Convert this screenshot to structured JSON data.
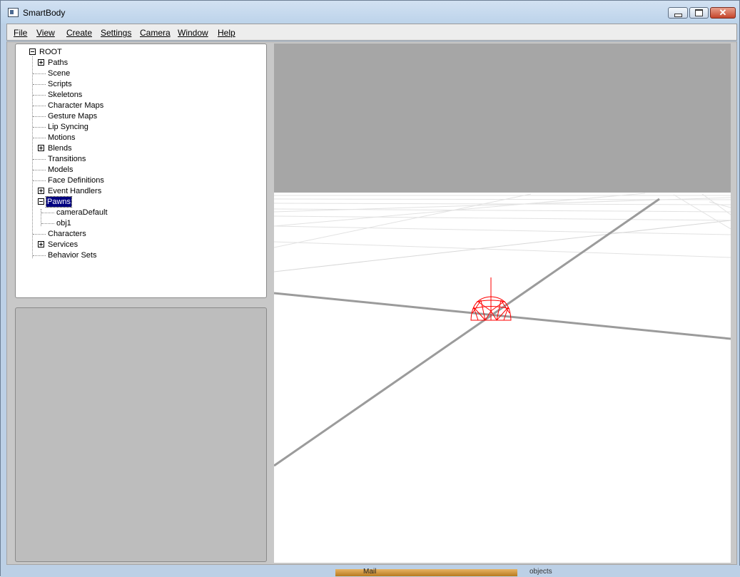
{
  "window": {
    "title": "SmartBody",
    "icon": "app-window-icon",
    "controls": {
      "minimize": "minimize-icon",
      "maximize": "maximize-icon",
      "close": "close-icon",
      "close_glyph": "✕"
    }
  },
  "menubar": {
    "items": [
      {
        "label": "File",
        "name": "menu-file"
      },
      {
        "label": "View",
        "name": "menu-view"
      },
      {
        "label": "Create",
        "name": "menu-create"
      },
      {
        "label": "Settings",
        "name": "menu-settings"
      },
      {
        "label": "Camera",
        "name": "menu-camera"
      },
      {
        "label": "Window",
        "name": "menu-window"
      },
      {
        "label": "Help",
        "name": "menu-help"
      }
    ]
  },
  "tree": {
    "root": {
      "label": "ROOT",
      "expanded": true
    },
    "items": [
      {
        "label": "Paths",
        "expandable": true,
        "expanded": false
      },
      {
        "label": "Scene",
        "expandable": false
      },
      {
        "label": "Scripts",
        "expandable": false
      },
      {
        "label": "Skeletons",
        "expandable": false
      },
      {
        "label": "Character Maps",
        "expandable": false
      },
      {
        "label": "Gesture Maps",
        "expandable": false
      },
      {
        "label": "Lip Syncing",
        "expandable": false
      },
      {
        "label": "Motions",
        "expandable": false
      },
      {
        "label": "Blends",
        "expandable": true,
        "expanded": false
      },
      {
        "label": "Transitions",
        "expandable": false
      },
      {
        "label": "Models",
        "expandable": false
      },
      {
        "label": "Face Definitions",
        "expandable": false
      },
      {
        "label": "Event Handlers",
        "expandable": true,
        "expanded": false
      },
      {
        "label": "Pawns",
        "expandable": true,
        "expanded": true,
        "selected": true,
        "children": [
          {
            "label": "cameraDefault"
          },
          {
            "label": "obj1"
          }
        ]
      },
      {
        "label": "Characters",
        "expandable": false
      },
      {
        "label": "Services",
        "expandable": true,
        "expanded": false
      },
      {
        "label": "Behavior Sets",
        "expandable": false
      }
    ]
  },
  "viewport": {
    "sky_color": "#a6a6a6",
    "ground_color": "#ffffff",
    "grid_color": "#dcdcdc",
    "axis_color": "#999999",
    "pawn_color": "#ff0000"
  },
  "taskbar": {
    "item": "Mail",
    "desktop_text": "objects"
  }
}
